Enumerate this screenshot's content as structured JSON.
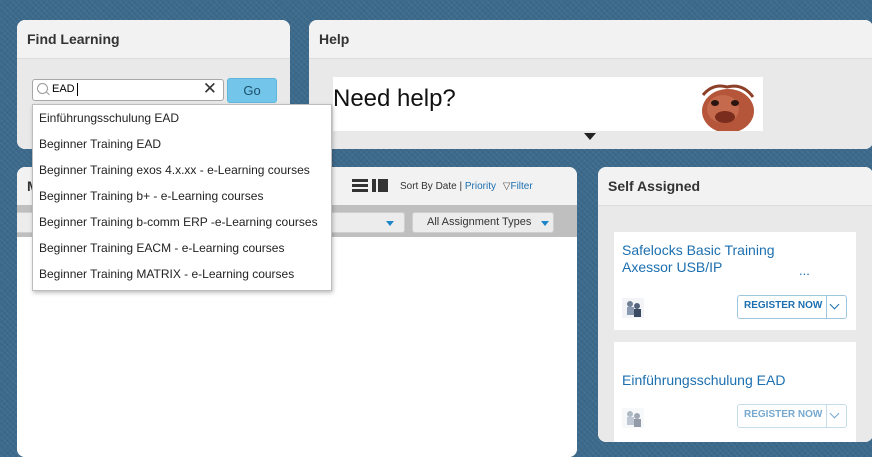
{
  "find_learning": {
    "title": "Find Learning",
    "search_value": "EAD",
    "clear_glyph": "✕",
    "go_label": "Go",
    "suggestions": [
      "Einführungsschulung EAD",
      "Beginner Training EAD",
      "Beginner Training exos 4.x.xx - e-Learning courses",
      "Beginner Training b+ - e-Learning courses",
      "Beginner Training b-comm ERP -e-Learning courses",
      "Beginner Training EACM - e-Learning courses",
      "Beginner Training MATRIX - e-Learning courses"
    ]
  },
  "help": {
    "title": "Help",
    "banner_text": "Need help?"
  },
  "my_learning": {
    "title_visible": "M",
    "sort_label": "Sort By Date |",
    "sort_priority": "Priority",
    "filter_label": "Filter",
    "assignment_types": "All Assignment Types"
  },
  "self_assigned": {
    "title": "Self Assigned",
    "cards": [
      {
        "title_line1": "Safelocks Basic Training",
        "title_line2": "Axessor USB/IP",
        "ellipsis": "...",
        "button": "REGISTER NOW"
      },
      {
        "title_line1": "Einführungsschulung EAD",
        "button": "REGISTER NOW"
      }
    ]
  },
  "colors": {
    "accent": "#73c6ea",
    "link": "#1c6fb0",
    "background": "#3d6a8c"
  },
  "icons": [
    "search-icon",
    "clear-icon",
    "list-view-icon",
    "detail-view-icon",
    "filter-icon",
    "chevron-down-icon"
  ]
}
